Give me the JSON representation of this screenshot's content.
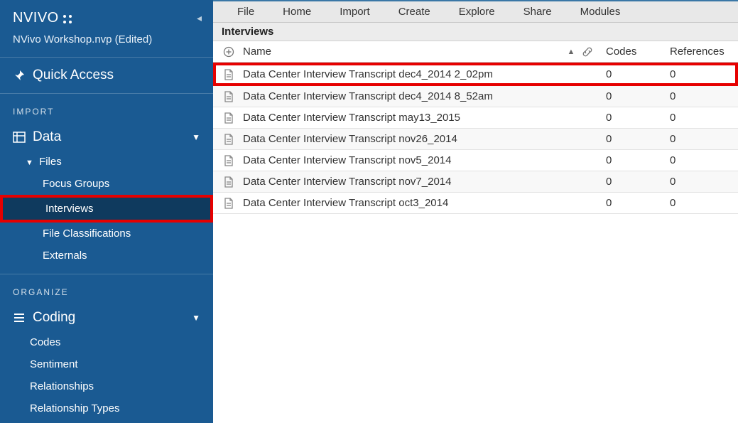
{
  "app": {
    "name": "NVIVO",
    "file": "NVivo Workshop.nvp (Edited)"
  },
  "sidebar": {
    "quick_access": "Quick Access",
    "section_import": "IMPORT",
    "group_data": "Data",
    "sub_files": "Files",
    "items_files": [
      "Focus Groups",
      "Interviews",
      "File Classifications",
      "Externals"
    ],
    "selected_file_index": 1,
    "section_organize": "ORGANIZE",
    "group_coding": "Coding",
    "items_coding": [
      "Codes",
      "Sentiment",
      "Relationships",
      "Relationship Types"
    ]
  },
  "menu": [
    "File",
    "Home",
    "Import",
    "Create",
    "Explore",
    "Share",
    "Modules"
  ],
  "view": {
    "title": "Interviews",
    "columns": {
      "name": "Name",
      "codes": "Codes",
      "refs": "References"
    },
    "rows": [
      {
        "name": "Data Center Interview Transcript dec4_2014 2_02pm",
        "codes": 0,
        "refs": 0,
        "highlight": true
      },
      {
        "name": "Data Center Interview Transcript dec4_2014 8_52am",
        "codes": 0,
        "refs": 0
      },
      {
        "name": "Data Center Interview Transcript may13_2015",
        "codes": 0,
        "refs": 0
      },
      {
        "name": "Data Center Interview Transcript nov26_2014",
        "codes": 0,
        "refs": 0
      },
      {
        "name": "Data Center Interview Transcript nov5_2014",
        "codes": 0,
        "refs": 0
      },
      {
        "name": "Data Center Interview Transcript nov7_2014",
        "codes": 0,
        "refs": 0
      },
      {
        "name": "Data Center Interview Transcript oct3_2014",
        "codes": 0,
        "refs": 0
      }
    ]
  }
}
